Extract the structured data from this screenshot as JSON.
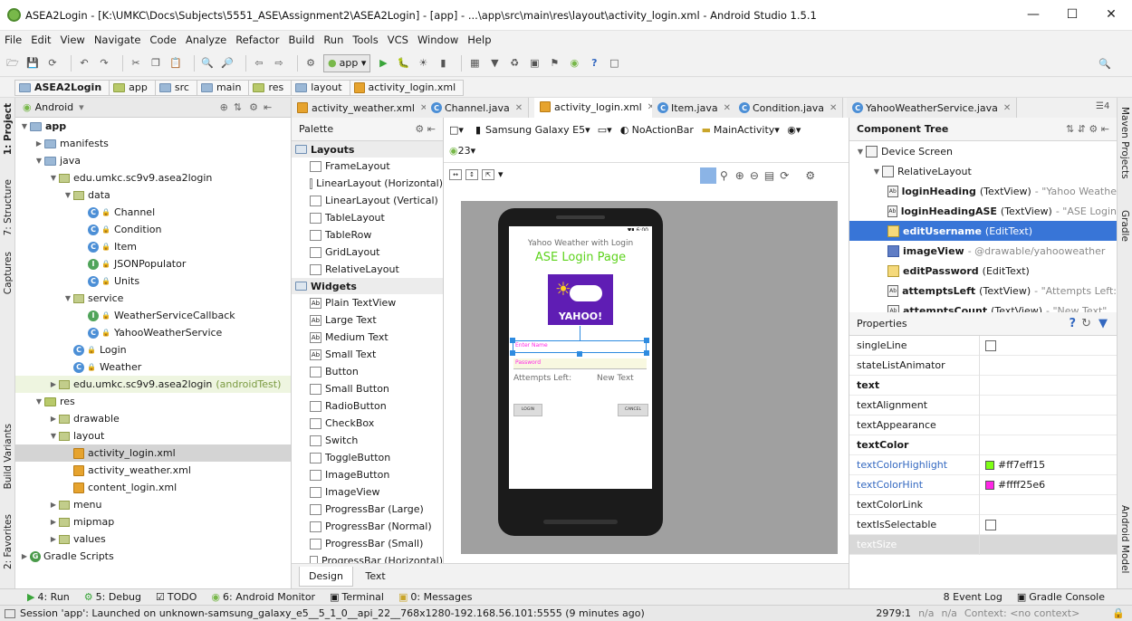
{
  "window": {
    "title": "ASEA2Login - [K:\\UMKC\\Docs\\Subjects\\5551_ASE\\Assignment2\\ASEA2Login] - [app] - ...\\app\\src\\main\\res\\layout\\activity_login.xml - Android Studio 1.5.1"
  },
  "menu": [
    "File",
    "Edit",
    "View",
    "Navigate",
    "Code",
    "Analyze",
    "Refactor",
    "Build",
    "Run",
    "Tools",
    "VCS",
    "Window",
    "Help"
  ],
  "toolbar": {
    "run_config": "app"
  },
  "breadcrumbs": [
    "ASEA2Login",
    "app",
    "src",
    "main",
    "res",
    "layout",
    "activity_login.xml"
  ],
  "side_tabs_left": [
    "1: Project",
    "7: Structure",
    "Captures",
    "Build Variants",
    "2: Favorites"
  ],
  "side_tabs_right": [
    "Maven Projects",
    "Gradle",
    "Android Model"
  ],
  "project": {
    "view_mode": "Android",
    "tree": [
      {
        "label": "app",
        "depth": 0,
        "kind": "folder",
        "open": true
      },
      {
        "label": "manifests",
        "depth": 1,
        "kind": "folder",
        "open": false
      },
      {
        "label": "java",
        "depth": 1,
        "kind": "folder",
        "open": true
      },
      {
        "label": "edu.umkc.sc9v9.asea2login",
        "depth": 2,
        "kind": "pkg",
        "open": true
      },
      {
        "label": "data",
        "depth": 3,
        "kind": "pkg",
        "open": true
      },
      {
        "label": "Channel",
        "depth": 4,
        "kind": "class"
      },
      {
        "label": "Condition",
        "depth": 4,
        "kind": "class"
      },
      {
        "label": "Item",
        "depth": 4,
        "kind": "class"
      },
      {
        "label": "JSONPopulator",
        "depth": 4,
        "kind": "iface"
      },
      {
        "label": "Units",
        "depth": 4,
        "kind": "class"
      },
      {
        "label": "service",
        "depth": 3,
        "kind": "pkg",
        "open": true
      },
      {
        "label": "WeatherServiceCallback",
        "depth": 4,
        "kind": "iface"
      },
      {
        "label": "YahooWeatherService",
        "depth": 4,
        "kind": "class"
      },
      {
        "label": "Login",
        "depth": 3,
        "kind": "class"
      },
      {
        "label": "Weather",
        "depth": 3,
        "kind": "class"
      },
      {
        "label": "edu.umkc.sc9v9.asea2login",
        "suffix": "(androidTest)",
        "depth": 2,
        "kind": "pkg",
        "open": false,
        "highlight": true
      },
      {
        "label": "res",
        "depth": 1,
        "kind": "res",
        "open": true
      },
      {
        "label": "drawable",
        "depth": 2,
        "kind": "pkg",
        "open": false
      },
      {
        "label": "layout",
        "depth": 2,
        "kind": "pkg",
        "open": true
      },
      {
        "label": "activity_login.xml",
        "depth": 3,
        "kind": "xml",
        "selected": true
      },
      {
        "label": "activity_weather.xml",
        "depth": 3,
        "kind": "xml"
      },
      {
        "label": "content_login.xml",
        "depth": 3,
        "kind": "xml"
      },
      {
        "label": "menu",
        "depth": 2,
        "kind": "pkg",
        "open": false
      },
      {
        "label": "mipmap",
        "depth": 2,
        "kind": "pkg",
        "open": false
      },
      {
        "label": "values",
        "depth": 2,
        "kind": "pkg",
        "open": false
      },
      {
        "label": "Gradle Scripts",
        "depth": 0,
        "kind": "gradle",
        "open": false
      }
    ]
  },
  "tabs": [
    {
      "label": "activity_weather.xml",
      "kind": "xml"
    },
    {
      "label": "Channel.java",
      "kind": "class"
    },
    {
      "label": "activity_login.xml",
      "kind": "xml",
      "active": true
    },
    {
      "label": "Item.java",
      "kind": "class"
    },
    {
      "label": "Condition.java",
      "kind": "class"
    },
    {
      "label": "YahooWeatherService.java",
      "kind": "class"
    }
  ],
  "palette": {
    "title": "Palette",
    "layouts_label": "Layouts",
    "layouts": [
      "FrameLayout",
      "LinearLayout (Horizontal)",
      "LinearLayout (Vertical)",
      "TableLayout",
      "TableRow",
      "GridLayout",
      "RelativeLayout"
    ],
    "widgets_label": "Widgets",
    "widgets": [
      "Plain TextView",
      "Large Text",
      "Medium Text",
      "Small Text",
      "Button",
      "Small Button",
      "RadioButton",
      "CheckBox",
      "Switch",
      "ToggleButton",
      "ImageButton",
      "ImageView",
      "ProgressBar (Large)",
      "ProgressBar (Normal)",
      "ProgressBar (Small)",
      "ProgressBar (Horizontal)"
    ]
  },
  "designer": {
    "device": "Samsung Galaxy E5",
    "theme": "NoActionBar",
    "activity": "MainActivity",
    "api": "23",
    "status_time": "6:00",
    "heading": "Yahoo Weather with Login",
    "heading_ase": "ASE Login Page",
    "yahoo_text": "YAHOO!",
    "username_hint": "Enter Name",
    "password_hint": "Password",
    "attempts_left": "Attempts Left:",
    "attempts_count": "New Text",
    "login_btn": "LOGIN",
    "cancel_btn": "CANCEL",
    "tab_design": "Design",
    "tab_text": "Text"
  },
  "component_tree": {
    "title": "Component Tree",
    "items": [
      {
        "name": "Device Screen",
        "depth": 0,
        "icon": "screen"
      },
      {
        "name": "RelativeLayout",
        "depth": 1,
        "icon": "layout"
      },
      {
        "name": "loginHeading",
        "type": "(TextView)",
        "extra": "- \"Yahoo Weathe",
        "depth": 2,
        "icon": "text"
      },
      {
        "name": "loginHeadingASE",
        "type": "(TextView)",
        "extra": "- \"ASE Login",
        "depth": 2,
        "icon": "text"
      },
      {
        "name": "editUsername",
        "type": "(EditText)",
        "extra": "",
        "depth": 2,
        "icon": "edit",
        "selected": true
      },
      {
        "name": "imageView",
        "type": "",
        "extra": "- @drawable/yahooweather",
        "depth": 2,
        "icon": "img"
      },
      {
        "name": "editPassword",
        "type": "(EditText)",
        "extra": "",
        "depth": 2,
        "icon": "edit"
      },
      {
        "name": "attemptsLeft",
        "type": "(TextView)",
        "extra": "- \"Attempts Left:",
        "depth": 2,
        "icon": "text"
      },
      {
        "name": "attemptsCount",
        "type": "(TextView)",
        "extra": "- \"New Text\"",
        "depth": 2,
        "icon": "text"
      }
    ]
  },
  "properties": {
    "title": "Properties",
    "rows": [
      {
        "name": "singleLine",
        "value": "",
        "kind": "checkbox"
      },
      {
        "name": "stateListAnimator",
        "value": ""
      },
      {
        "name": "text",
        "value": "",
        "bold": true
      },
      {
        "name": "textAlignment",
        "value": ""
      },
      {
        "name": "textAppearance",
        "value": ""
      },
      {
        "name": "textColor",
        "value": "",
        "bold": true
      },
      {
        "name": "textColorHighlight",
        "value": "#ff7eff15",
        "kind": "color",
        "color": "#7eff15",
        "blue": true
      },
      {
        "name": "textColorHint",
        "value": "#ffff25e6",
        "kind": "color",
        "color": "#ff25e6",
        "blue": true
      },
      {
        "name": "textColorLink",
        "value": ""
      },
      {
        "name": "textIsSelectable",
        "value": "",
        "kind": "checkbox"
      },
      {
        "name": "textSize",
        "value": "",
        "dim": true
      }
    ]
  },
  "tool_windows": [
    "4: Run",
    "5: Debug",
    "TODO",
    "6: Android Monitor",
    "Terminal",
    "0: Messages"
  ],
  "tool_windows_right": [
    "8 Event Log",
    "Gradle Console"
  ],
  "status": {
    "message": "Session 'app': Launched on unknown-samsung_galaxy_e5__5_1_0__api_22__768x1280-192.168.56.101:5555 (9 minutes ago)",
    "position": "2979:1",
    "na1": "n/a",
    "na2": "n/a",
    "context": "Context: <no context>"
  }
}
